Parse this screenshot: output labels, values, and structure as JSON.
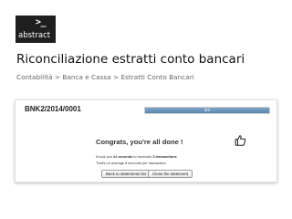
{
  "logo": {
    "prompt": ">_",
    "name": "abstract"
  },
  "page": {
    "title": "Riconciliazione estratti conto bancari",
    "breadcrumb": [
      "Contabilità",
      "Banca e Cassa",
      "Estratti Conto Bancari"
    ],
    "breadcrumb_separator": ">"
  },
  "panel": {
    "statement_name": "BNK2/2014/0001",
    "progress": {
      "percent": 100,
      "label": "4/4"
    },
    "congrats_text": "Congrats, you're all done !",
    "summary_line1": {
      "pre": "It took you ",
      "duration": "24 seconds",
      "mid": " to reconcile ",
      "count": "3 transactions",
      "post": "."
    },
    "summary_line2": "That's on average 8 seconds per transaction.",
    "buttons": {
      "back": "Back to statements list",
      "close": "Close the statement"
    }
  },
  "colors": {
    "accent": "#6b93b8",
    "logo_bg": "#1f1f1f"
  },
  "icons": {
    "success": "thumbs-up-icon"
  }
}
